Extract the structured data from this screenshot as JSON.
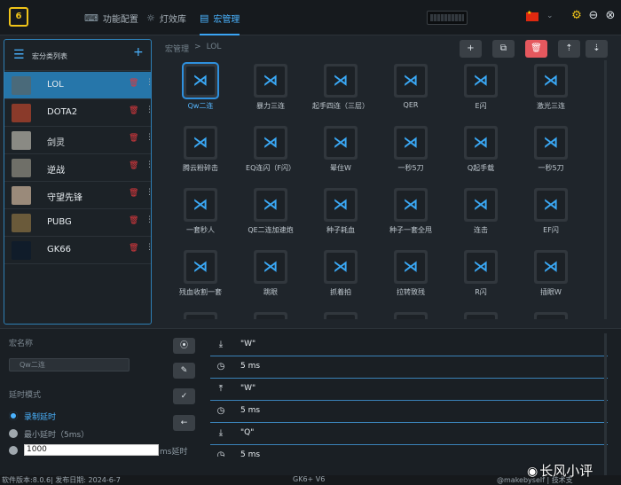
{
  "topbar": {
    "logo": "6",
    "tabs": [
      {
        "label": "功能配置",
        "icon": "keyboard-icon"
      },
      {
        "label": "灯效库",
        "icon": "sun-icon"
      },
      {
        "label": "宏管理",
        "icon": "file-icon"
      }
    ],
    "active_tab": "宏管理",
    "language_icon": "china-flag-icon"
  },
  "sidebar": {
    "title": "宏分类列表",
    "add_icon": "plus-icon",
    "games": [
      {
        "name": "LOL",
        "thumb": "#4a6a7a",
        "active": true
      },
      {
        "name": "DOTA2",
        "thumb": "#8a3a2a",
        "active": false
      },
      {
        "name": "剑灵",
        "thumb": "#8a8a84",
        "active": false
      },
      {
        "name": "逆战",
        "thumb": "#6f6f68",
        "active": false
      },
      {
        "name": "守望先锋",
        "thumb": "#9a8a7a",
        "active": false
      },
      {
        "name": "PUBG",
        "thumb": "#6a5a3a",
        "active": false
      },
      {
        "name": "GK66",
        "thumb": "#101c2a",
        "active": false
      }
    ],
    "delete_icon": "trash-icon",
    "more_icon": "dots-icon"
  },
  "breadcrumb": {
    "root": "宏管理",
    "separator": ">",
    "current": "LOL"
  },
  "actions": [
    {
      "label": "+",
      "name": "add-macro-button",
      "icon": "plus-icon"
    },
    {
      "label": "⧉",
      "name": "copy-macro-button",
      "icon": "copy-icon"
    },
    {
      "label": "🗑",
      "name": "delete-macro-button",
      "icon": "trash-icon"
    },
    {
      "label": "⇡",
      "name": "export-macro-button",
      "icon": "upload-icon"
    },
    {
      "label": "⇣",
      "name": "import-macro-button",
      "icon": "download-icon"
    }
  ],
  "macros": [
    "Qw二连",
    "暴力三连",
    "起手四连（三层）",
    "QER",
    "E闪",
    "激光三连",
    "腾云粉碎击",
    "EQ连闪（F闪）",
    "晕住W",
    "一秒5刀",
    "Q起手载",
    "一秒5刀",
    "一套秒人",
    "QE二连加速炮",
    "种子耗血",
    "种子一套全甩",
    "连击",
    "EF闪",
    "残血收割一套",
    "跳眼",
    "抓着拍",
    "拉转致残",
    "R闪",
    "插眼W"
  ],
  "selected_macro": "Qw二连",
  "editor": {
    "name_label": "宏名称",
    "name_value": "Qw二连",
    "delay_label": "延时模式",
    "delay_options": [
      {
        "label": "录制延时",
        "selected": true
      },
      {
        "label": "最小延时（5ms）",
        "selected": false
      }
    ],
    "custom_delay_value": "1000",
    "custom_delay_unit": "ms延时",
    "record_buttons": [
      {
        "label": "⦿",
        "name": "record-button",
        "icon": "record-icon"
      },
      {
        "label": "✎",
        "name": "edit-button",
        "icon": "pencil-icon"
      },
      {
        "label": "✓",
        "name": "confirm-button",
        "icon": "check-icon"
      },
      {
        "label": "←",
        "name": "back-button",
        "icon": "arrow-left-icon"
      }
    ],
    "steps": [
      {
        "icon": "⤓",
        "icon_name": "key-down-icon",
        "text": "\"W\""
      },
      {
        "icon": "◷",
        "icon_name": "clock-icon",
        "text": "5 ms"
      },
      {
        "icon": "⤒",
        "icon_name": "key-up-icon",
        "text": "\"W\""
      },
      {
        "icon": "◷",
        "icon_name": "clock-icon",
        "text": "5 ms"
      },
      {
        "icon": "⤓",
        "icon_name": "key-down-icon",
        "text": "\"Q\""
      },
      {
        "icon": "◷",
        "icon_name": "clock-icon",
        "text": "5 ms"
      }
    ]
  },
  "status": {
    "left": "软件版本:8.0.6| 发布日期: 2024-6-7",
    "center": "GK6+ V6",
    "right": "@makebyself | 技术支持:makebyself"
  },
  "watermark": "长风小评",
  "colors": {
    "accent": "#3aa4f4",
    "danger": "#e5585e",
    "gold": "#f0c419"
  }
}
